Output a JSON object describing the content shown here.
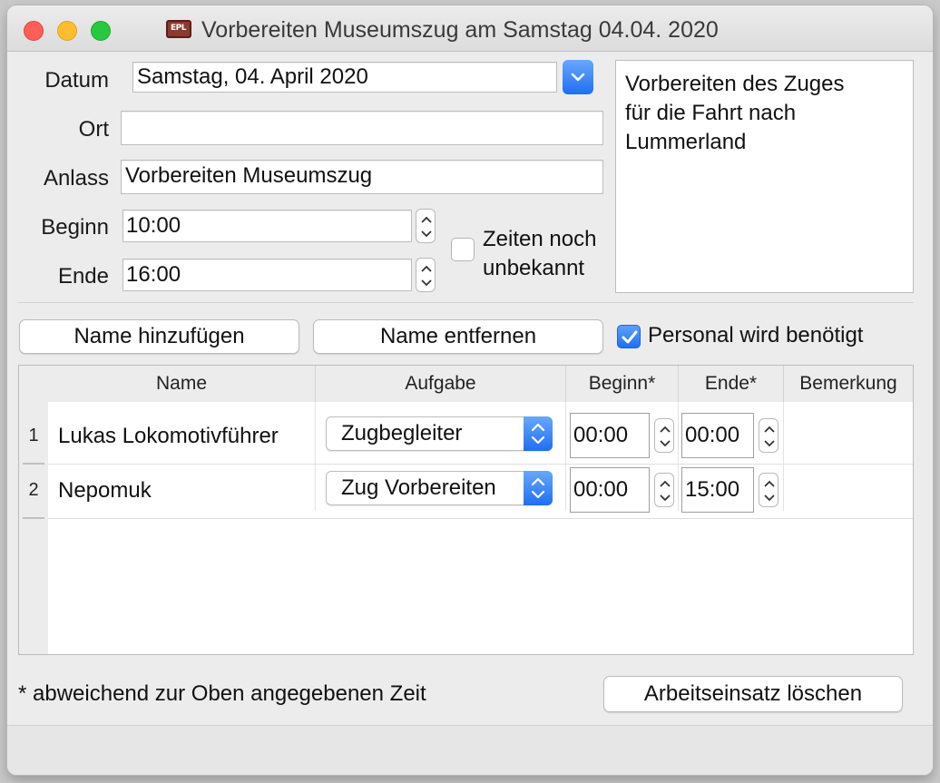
{
  "window": {
    "title": "Vorbereiten Museumszug am Samstag 04.04. 2020",
    "app_icon": "EPL"
  },
  "form": {
    "datum_label": "Datum",
    "datum_value": "Samstag, 04. April 2020",
    "ort_label": "Ort",
    "ort_value": "",
    "anlass_label": "Anlass",
    "anlass_value": "Vorbereiten Museumszug",
    "beginn_label": "Beginn",
    "beginn_value": "10:00",
    "ende_label": "Ende",
    "ende_value": "16:00",
    "zeiten_unbekannt_label_1": "Zeiten noch",
    "zeiten_unbekannt_label_2": "unbekannt",
    "zeiten_unbekannt_checked": false,
    "notes": [
      "Vorbereiten des Zuges",
      "für die Fahrt nach",
      "Lummerland"
    ]
  },
  "actions": {
    "add_name": "Name hinzufügen",
    "remove_name": "Name entfernen",
    "personal_label": "Personal wird benötigt",
    "personal_checked": true
  },
  "table": {
    "headers": [
      "Name",
      "Aufgabe",
      "Beginn*",
      "Ende*",
      "Bemerkung"
    ],
    "rows": [
      {
        "num": "1",
        "name": "Lukas Lokomotivführer",
        "aufgabe": "Zugbegleiter",
        "beginn": "00:00",
        "ende": "00:00",
        "bemerkung": ""
      },
      {
        "num": "2",
        "name": "Nepomuk",
        "aufgabe": "Zug Vorbereiten",
        "beginn": "00:00",
        "ende": "15:00",
        "bemerkung": ""
      }
    ]
  },
  "footer": {
    "footnote": "* abweichend zur Oben angegebenen Zeit",
    "delete_button": "Arbeitseinsatz löschen"
  },
  "colors": {
    "accent_blue": "#1f6ff2",
    "close": "#fe5f57",
    "minimize": "#febc2e",
    "zoom": "#28c840"
  }
}
